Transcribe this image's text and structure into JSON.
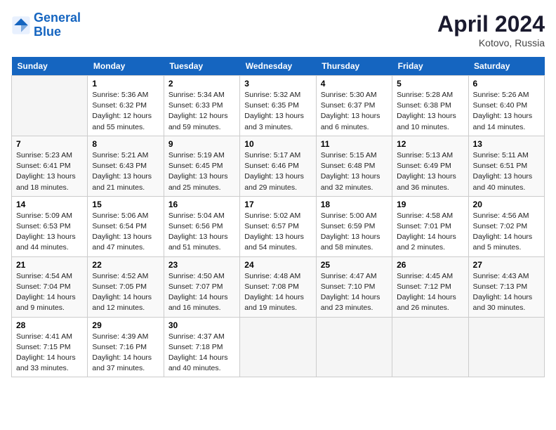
{
  "header": {
    "logo_line1": "General",
    "logo_line2": "Blue",
    "month": "April 2024",
    "location": "Kotovo, Russia"
  },
  "weekdays": [
    "Sunday",
    "Monday",
    "Tuesday",
    "Wednesday",
    "Thursday",
    "Friday",
    "Saturday"
  ],
  "weeks": [
    [
      {
        "day": "",
        "content": ""
      },
      {
        "day": "1",
        "content": "Sunrise: 5:36 AM\nSunset: 6:32 PM\nDaylight: 12 hours\nand 55 minutes."
      },
      {
        "day": "2",
        "content": "Sunrise: 5:34 AM\nSunset: 6:33 PM\nDaylight: 12 hours\nand 59 minutes."
      },
      {
        "day": "3",
        "content": "Sunrise: 5:32 AM\nSunset: 6:35 PM\nDaylight: 13 hours\nand 3 minutes."
      },
      {
        "day": "4",
        "content": "Sunrise: 5:30 AM\nSunset: 6:37 PM\nDaylight: 13 hours\nand 6 minutes."
      },
      {
        "day": "5",
        "content": "Sunrise: 5:28 AM\nSunset: 6:38 PM\nDaylight: 13 hours\nand 10 minutes."
      },
      {
        "day": "6",
        "content": "Sunrise: 5:26 AM\nSunset: 6:40 PM\nDaylight: 13 hours\nand 14 minutes."
      }
    ],
    [
      {
        "day": "7",
        "content": "Sunrise: 5:23 AM\nSunset: 6:41 PM\nDaylight: 13 hours\nand 18 minutes."
      },
      {
        "day": "8",
        "content": "Sunrise: 5:21 AM\nSunset: 6:43 PM\nDaylight: 13 hours\nand 21 minutes."
      },
      {
        "day": "9",
        "content": "Sunrise: 5:19 AM\nSunset: 6:45 PM\nDaylight: 13 hours\nand 25 minutes."
      },
      {
        "day": "10",
        "content": "Sunrise: 5:17 AM\nSunset: 6:46 PM\nDaylight: 13 hours\nand 29 minutes."
      },
      {
        "day": "11",
        "content": "Sunrise: 5:15 AM\nSunset: 6:48 PM\nDaylight: 13 hours\nand 32 minutes."
      },
      {
        "day": "12",
        "content": "Sunrise: 5:13 AM\nSunset: 6:49 PM\nDaylight: 13 hours\nand 36 minutes."
      },
      {
        "day": "13",
        "content": "Sunrise: 5:11 AM\nSunset: 6:51 PM\nDaylight: 13 hours\nand 40 minutes."
      }
    ],
    [
      {
        "day": "14",
        "content": "Sunrise: 5:09 AM\nSunset: 6:53 PM\nDaylight: 13 hours\nand 44 minutes."
      },
      {
        "day": "15",
        "content": "Sunrise: 5:06 AM\nSunset: 6:54 PM\nDaylight: 13 hours\nand 47 minutes."
      },
      {
        "day": "16",
        "content": "Sunrise: 5:04 AM\nSunset: 6:56 PM\nDaylight: 13 hours\nand 51 minutes."
      },
      {
        "day": "17",
        "content": "Sunrise: 5:02 AM\nSunset: 6:57 PM\nDaylight: 13 hours\nand 54 minutes."
      },
      {
        "day": "18",
        "content": "Sunrise: 5:00 AM\nSunset: 6:59 PM\nDaylight: 13 hours\nand 58 minutes."
      },
      {
        "day": "19",
        "content": "Sunrise: 4:58 AM\nSunset: 7:01 PM\nDaylight: 14 hours\nand 2 minutes."
      },
      {
        "day": "20",
        "content": "Sunrise: 4:56 AM\nSunset: 7:02 PM\nDaylight: 14 hours\nand 5 minutes."
      }
    ],
    [
      {
        "day": "21",
        "content": "Sunrise: 4:54 AM\nSunset: 7:04 PM\nDaylight: 14 hours\nand 9 minutes."
      },
      {
        "day": "22",
        "content": "Sunrise: 4:52 AM\nSunset: 7:05 PM\nDaylight: 14 hours\nand 12 minutes."
      },
      {
        "day": "23",
        "content": "Sunrise: 4:50 AM\nSunset: 7:07 PM\nDaylight: 14 hours\nand 16 minutes."
      },
      {
        "day": "24",
        "content": "Sunrise: 4:48 AM\nSunset: 7:08 PM\nDaylight: 14 hours\nand 19 minutes."
      },
      {
        "day": "25",
        "content": "Sunrise: 4:47 AM\nSunset: 7:10 PM\nDaylight: 14 hours\nand 23 minutes."
      },
      {
        "day": "26",
        "content": "Sunrise: 4:45 AM\nSunset: 7:12 PM\nDaylight: 14 hours\nand 26 minutes."
      },
      {
        "day": "27",
        "content": "Sunrise: 4:43 AM\nSunset: 7:13 PM\nDaylight: 14 hours\nand 30 minutes."
      }
    ],
    [
      {
        "day": "28",
        "content": "Sunrise: 4:41 AM\nSunset: 7:15 PM\nDaylight: 14 hours\nand 33 minutes."
      },
      {
        "day": "29",
        "content": "Sunrise: 4:39 AM\nSunset: 7:16 PM\nDaylight: 14 hours\nand 37 minutes."
      },
      {
        "day": "30",
        "content": "Sunrise: 4:37 AM\nSunset: 7:18 PM\nDaylight: 14 hours\nand 40 minutes."
      },
      {
        "day": "",
        "content": ""
      },
      {
        "day": "",
        "content": ""
      },
      {
        "day": "",
        "content": ""
      },
      {
        "day": "",
        "content": ""
      }
    ]
  ]
}
